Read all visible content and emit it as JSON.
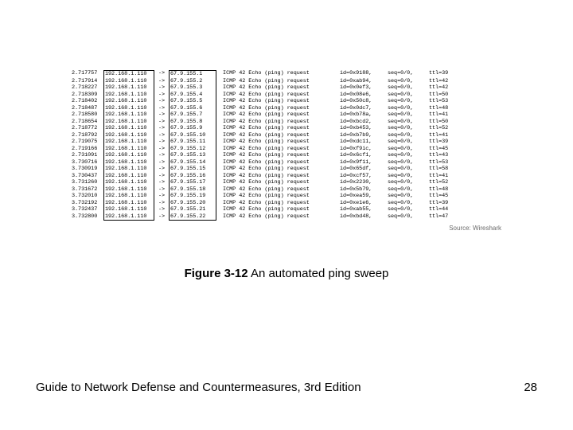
{
  "capture": {
    "src": "192.168.1.110",
    "arrow": "->",
    "proto_line": "ICMP 42 Echo (ping) request",
    "seq": "seq=0/0,",
    "rows": [
      {
        "time": "2.717757",
        "dst": "67.9.155.1",
        "id": "id=0x9188,",
        "ttl": "ttl=39"
      },
      {
        "time": "2.717914",
        "dst": "67.9.155.2",
        "id": "id=0xab94,",
        "ttl": "ttl=42"
      },
      {
        "time": "2.718227",
        "dst": "67.9.155.3",
        "id": "id=0x0ef3,",
        "ttl": "ttl=42"
      },
      {
        "time": "2.718309",
        "dst": "67.9.155.4",
        "id": "id=0x08e6,",
        "ttl": "ttl=50"
      },
      {
        "time": "2.718402",
        "dst": "67.9.155.5",
        "id": "id=0x50c8,",
        "ttl": "ttl=53"
      },
      {
        "time": "2.718487",
        "dst": "67.9.155.6",
        "id": "id=0x0dc7,",
        "ttl": "ttl=48"
      },
      {
        "time": "2.718580",
        "dst": "67.9.155.7",
        "id": "id=0xb78a,",
        "ttl": "ttl=41"
      },
      {
        "time": "2.718654",
        "dst": "67.9.155.8",
        "id": "id=0xbcd2,",
        "ttl": "ttl=50"
      },
      {
        "time": "2.718772",
        "dst": "67.9.155.9",
        "id": "id=0xb453,",
        "ttl": "ttl=52"
      },
      {
        "time": "2.718792",
        "dst": "67.9.155.10",
        "id": "id=0xb7b9,",
        "ttl": "ttl=41"
      },
      {
        "time": "2.719075",
        "dst": "67.9.155.11",
        "id": "id=0xdc11,",
        "ttl": "ttl=39"
      },
      {
        "time": "2.719166",
        "dst": "67.9.155.12",
        "id": "id=0xf9ic,",
        "ttl": "ttl=45"
      },
      {
        "time": "2.731091",
        "dst": "67.9.155.13",
        "id": "id=0x6cf1,",
        "ttl": "ttl=43"
      },
      {
        "time": "3.730716",
        "dst": "67.9.155.14",
        "id": "id=0x9f11,",
        "ttl": "ttl=53"
      },
      {
        "time": "3.730919",
        "dst": "67.9.155.15",
        "id": "id=0x65df,",
        "ttl": "ttl=58"
      },
      {
        "time": "3.730437",
        "dst": "67.9.155.16",
        "id": "id=0xcf57,",
        "ttl": "ttl=41"
      },
      {
        "time": "3.731260",
        "dst": "67.9.155.17",
        "id": "id=0x2230,",
        "ttl": "ttl=52"
      },
      {
        "time": "3.731672",
        "dst": "67.9.155.18",
        "id": "id=0x5b79,",
        "ttl": "ttl=48"
      },
      {
        "time": "3.732010",
        "dst": "67.9.155.19",
        "id": "id=0xea59,",
        "ttl": "ttl=45"
      },
      {
        "time": "3.732192",
        "dst": "67.9.155.20",
        "id": "id=0xe1e6,",
        "ttl": "ttl=39"
      },
      {
        "time": "3.732437",
        "dst": "67.9.155.21",
        "id": "id=0xab55,",
        "ttl": "ttl=44"
      },
      {
        "time": "3.732800",
        "dst": "67.9.155.22",
        "id": "id=0xbd48,",
        "ttl": "ttl=47"
      }
    ]
  },
  "source_credit": "Source: Wireshark",
  "figure": {
    "number": "Figure 3-12",
    "title": "  An automated ping sweep"
  },
  "footer": "Guide to Network Defense and Countermeasures, 3rd Edition",
  "page_number": "28"
}
